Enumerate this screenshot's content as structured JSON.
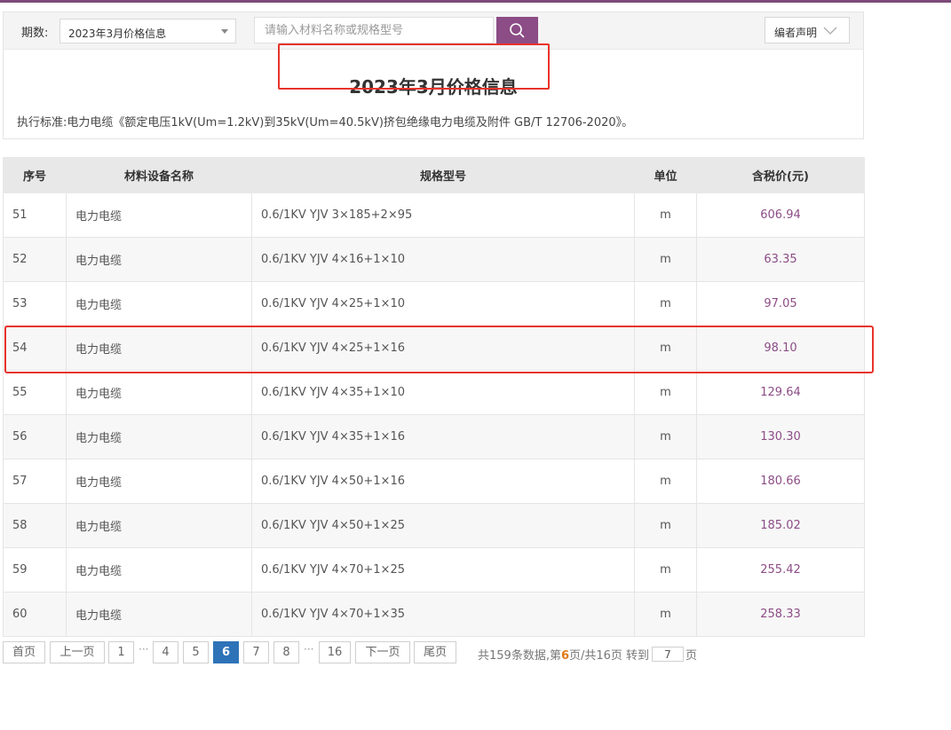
{
  "filter": {
    "period_label": "期数:",
    "period_value": "2023年3月价格信息",
    "search_placeholder": "请输入材料名称或规格型号",
    "note_button": "编者声明",
    "accent_color": "#8c4c86"
  },
  "doc": {
    "title": "2023年3月价格信息",
    "standard": "执行标准:电力电缆《额定电压1kV(Um=1.2kV)到35kV(Um=40.5kV)挤包绝缘电力电缆及附件 GB/T 12706-2020》。"
  },
  "table": {
    "headers": [
      "序号",
      "材料设备名称",
      "规格型号",
      "单位",
      "含税价(元)"
    ],
    "rows": [
      {
        "no": "51",
        "name": "电力电缆",
        "spec": "0.6/1KV YJV 3×185+2×95",
        "unit": "m",
        "price": "606.94"
      },
      {
        "no": "52",
        "name": "电力电缆",
        "spec": "0.6/1KV YJV 4×16+1×10",
        "unit": "m",
        "price": "63.35"
      },
      {
        "no": "53",
        "name": "电力电缆",
        "spec": "0.6/1KV YJV 4×25+1×10",
        "unit": "m",
        "price": "97.05"
      },
      {
        "no": "54",
        "name": "电力电缆",
        "spec": "0.6/1KV YJV 4×25+1×16",
        "unit": "m",
        "price": "98.10"
      },
      {
        "no": "55",
        "name": "电力电缆",
        "spec": "0.6/1KV YJV 4×35+1×10",
        "unit": "m",
        "price": "129.64"
      },
      {
        "no": "56",
        "name": "电力电缆",
        "spec": "0.6/1KV YJV 4×35+1×16",
        "unit": "m",
        "price": "130.30"
      },
      {
        "no": "57",
        "name": "电力电缆",
        "spec": "0.6/1KV YJV 4×50+1×16",
        "unit": "m",
        "price": "180.66"
      },
      {
        "no": "58",
        "name": "电力电缆",
        "spec": "0.6/1KV YJV 4×50+1×25",
        "unit": "m",
        "price": "185.02"
      },
      {
        "no": "59",
        "name": "电力电缆",
        "spec": "0.6/1KV YJV 4×70+1×25",
        "unit": "m",
        "price": "255.42"
      },
      {
        "no": "60",
        "name": "电力电缆",
        "spec": "0.6/1KV YJV 4×70+1×35",
        "unit": "m",
        "price": "258.33"
      }
    ]
  },
  "pager": {
    "first": "首页",
    "prev": "上一页",
    "pages": [
      "1",
      "4",
      "5",
      "6",
      "7",
      "8",
      "16"
    ],
    "current": "6",
    "ellipsis": "···",
    "next": "下一页",
    "last": "尾页",
    "info_prefix": "共159条数据,第",
    "info_current": "6",
    "info_suffix": "页/共16页 转到",
    "jump_value": "7",
    "jump_suffix": "页"
  }
}
